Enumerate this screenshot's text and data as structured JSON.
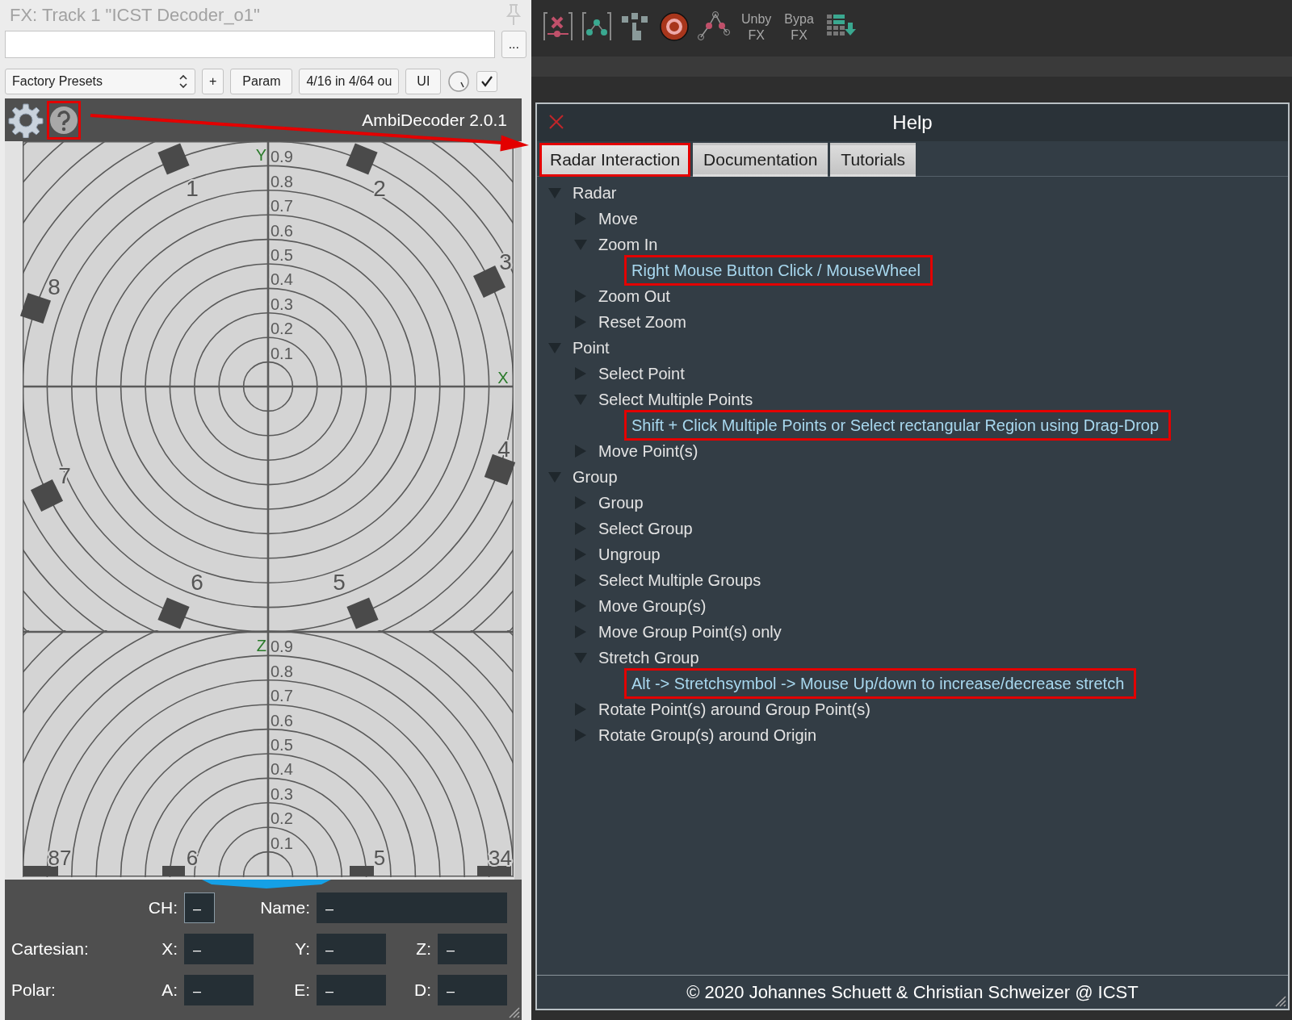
{
  "fx_window": {
    "title": "FX: Track 1 \"ICST Decoder_o1\"",
    "more_button": "...",
    "preset_select": "Factory Presets",
    "add_button": "+",
    "param_button": "Param",
    "io_button": "4/16 in 4/64 ou",
    "ui_button": "UI",
    "enabled_checkbox": {
      "checked": true
    }
  },
  "plugin": {
    "help_button": {
      "annotated": true
    },
    "title": "AmbiDecoder 2.0.1",
    "radar_top": {
      "axis_labels": [
        "Y",
        "X"
      ],
      "ticks": [
        "0.9",
        "0.8",
        "0.7",
        "0.6",
        "0.5",
        "0.4",
        "0.3",
        "0.2",
        "0.1"
      ],
      "speakers": [
        "1",
        "2",
        "3",
        "4",
        "5",
        "6",
        "7",
        "8"
      ]
    },
    "radar_bottom": {
      "axis_label": "Z",
      "ticks": [
        "0.9",
        "0.8",
        "0.7",
        "0.6",
        "0.5",
        "0.4",
        "0.3",
        "0.2",
        "0.1"
      ],
      "speaker_labels": [
        "87",
        "6",
        "5",
        "34"
      ]
    },
    "field_rows": [
      {
        "fields": [
          {
            "label": "CH:",
            "value": "–",
            "focused": true
          },
          {
            "label": "Name:",
            "value": "–",
            "focused": false
          }
        ]
      },
      {
        "label": "Cartesian:",
        "fields": [
          {
            "label": "X:",
            "value": "–",
            "focused": false
          },
          {
            "label": "Y:",
            "value": "–",
            "focused": false
          },
          {
            "label": "Z:",
            "value": "–",
            "focused": false
          }
        ]
      },
      {
        "label": "Polar:",
        "fields": [
          {
            "label": "A:",
            "value": "–",
            "focused": false
          },
          {
            "label": "E:",
            "value": "–",
            "focused": false
          },
          {
            "label": "D:",
            "value": "–",
            "focused": false
          }
        ]
      }
    ]
  },
  "toolbar": {
    "text_buttons": [
      "Unby FX",
      "Bypa FX"
    ]
  },
  "help": {
    "title": "Help",
    "tabs": [
      {
        "label": "Radar Interaction",
        "selected": true,
        "annotated": true
      },
      {
        "label": "Documentation",
        "selected": false,
        "annotated": false
      },
      {
        "label": "Tutorials",
        "selected": false,
        "annotated": false
      }
    ],
    "tree": [
      {
        "kind": "topic",
        "label": "Radar",
        "expanded": true,
        "children": [
          {
            "kind": "topic",
            "label": "Move",
            "expanded": false
          },
          {
            "kind": "topic",
            "label": "Zoom In",
            "expanded": true,
            "children": [
              {
                "kind": "hint",
                "text": "Right Mouse Button Click / MouseWheel",
                "highlighted": true
              }
            ]
          },
          {
            "kind": "topic",
            "label": "Zoom Out",
            "expanded": false
          },
          {
            "kind": "topic",
            "label": "Reset Zoom",
            "expanded": false
          }
        ]
      },
      {
        "kind": "topic",
        "label": "Point",
        "expanded": true,
        "children": [
          {
            "kind": "topic",
            "label": "Select Point",
            "expanded": false
          },
          {
            "kind": "topic",
            "label": "Select Multiple Points",
            "expanded": true,
            "children": [
              {
                "kind": "hint",
                "text": "Shift + Click Multiple Points or Select rectangular Region using Drag-Drop",
                "highlighted": true
              }
            ]
          },
          {
            "kind": "topic",
            "label": "Move Point(s)",
            "expanded": false
          }
        ]
      },
      {
        "kind": "topic",
        "label": "Group",
        "expanded": true,
        "children": [
          {
            "kind": "topic",
            "label": "Group",
            "expanded": false
          },
          {
            "kind": "topic",
            "label": "Select Group",
            "expanded": false
          },
          {
            "kind": "topic",
            "label": "Ungroup",
            "expanded": false
          },
          {
            "kind": "topic",
            "label": "Select Multiple Groups",
            "expanded": false
          },
          {
            "kind": "topic",
            "label": "Move Group(s)",
            "expanded": false
          },
          {
            "kind": "topic",
            "label": "Move Group Point(s) only",
            "expanded": false
          },
          {
            "kind": "topic",
            "label": "Stretch Group",
            "expanded": true,
            "children": [
              {
                "kind": "hint",
                "text": "Alt -> Stretchsymbol -> Mouse Up/down to increase/decrease stretch",
                "highlighted": true
              }
            ]
          },
          {
            "kind": "topic",
            "label": "Rotate Point(s) around Group Point(s)",
            "expanded": false
          },
          {
            "kind": "topic",
            "label": "Rotate Group(s) around Origin",
            "expanded": false
          }
        ]
      }
    ],
    "footer": "© 2020 Johannes Schuett & Christian Schweizer @ ICST"
  }
}
